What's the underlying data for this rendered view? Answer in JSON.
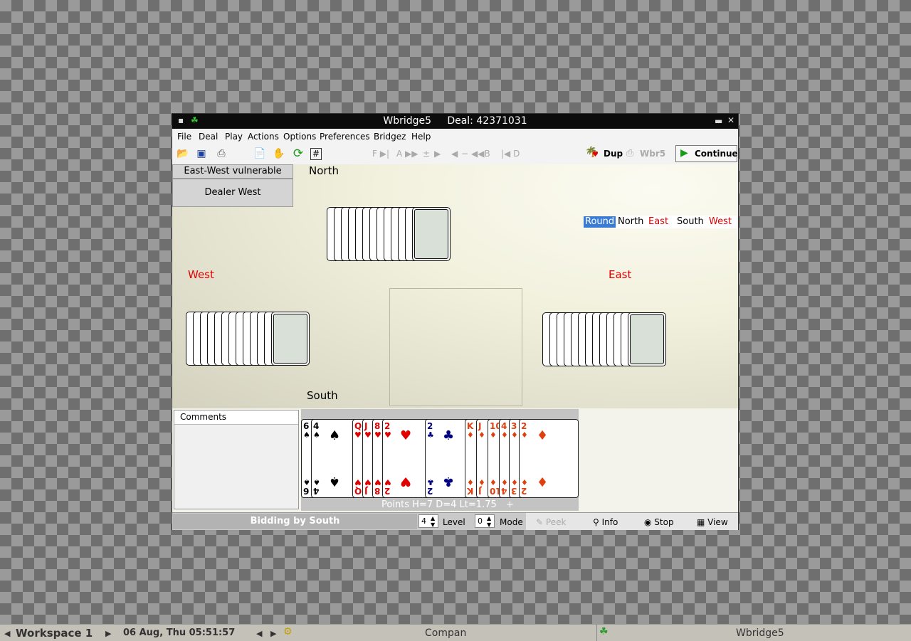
{
  "window": {
    "title": "Wbridge5",
    "deal_label": "Deal: 42371031"
  },
  "menu": [
    "File",
    "Deal",
    "Play",
    "Actions",
    "Options",
    "Preferences",
    "Bridgez",
    "Help"
  ],
  "toolbar": {
    "nav_disabled": [
      "F",
      "A",
      "±",
      "−",
      "B",
      "D"
    ],
    "dup_label": "Dup",
    "wbr5_label": "Wbr5",
    "continue_label": "Continue"
  },
  "table": {
    "vulnerability": "East-West vulnerable",
    "dealer": "Dealer West",
    "seats": {
      "north": "North",
      "west": "West",
      "east": "East",
      "south": "South"
    }
  },
  "round_tabs": [
    "Round",
    "North",
    "East",
    "South",
    "West"
  ],
  "comments": {
    "label": "Comments",
    "text": ""
  },
  "south_hand": [
    {
      "rank": "6",
      "suit": "♠",
      "color": "sp"
    },
    {
      "rank": "4",
      "suit": "♠",
      "color": "sp"
    },
    {
      "rank": "Q",
      "suit": "♥",
      "color": "ht"
    },
    {
      "rank": "J",
      "suit": "♥",
      "color": "ht"
    },
    {
      "rank": "8",
      "suit": "♥",
      "color": "ht"
    },
    {
      "rank": "2",
      "suit": "♥",
      "color": "ht"
    },
    {
      "rank": "2",
      "suit": "♣",
      "color": "cl"
    },
    {
      "rank": "K",
      "suit": "♦",
      "color": "dm"
    },
    {
      "rank": "J",
      "suit": "♦",
      "color": "dm"
    },
    {
      "rank": "10",
      "suit": "♦",
      "color": "dm"
    },
    {
      "rank": "4",
      "suit": "♦",
      "color": "dm"
    },
    {
      "rank": "3",
      "suit": "♦",
      "color": "dm"
    },
    {
      "rank": "2",
      "suit": "♦",
      "color": "dm"
    }
  ],
  "points": "Points H=7 D=4  Lt=1.75",
  "points_plus": "+",
  "status": {
    "bidding": "Bidding by South",
    "level_value": "4",
    "level_label": "Level",
    "mode_value": "0",
    "mode_label": "Mode",
    "peek_label": "Peek",
    "info_label": "Info",
    "stop_label": "Stop",
    "view_label": "View"
  },
  "taskbar": {
    "workspace": "Workspace 1",
    "datetime": "06 Aug, Thu 05:51:57",
    "task1": "Compan",
    "task2": "Wbridge5"
  },
  "colors": {
    "accent_blue": "#3a7bd5",
    "red_seat": "#e00000"
  }
}
